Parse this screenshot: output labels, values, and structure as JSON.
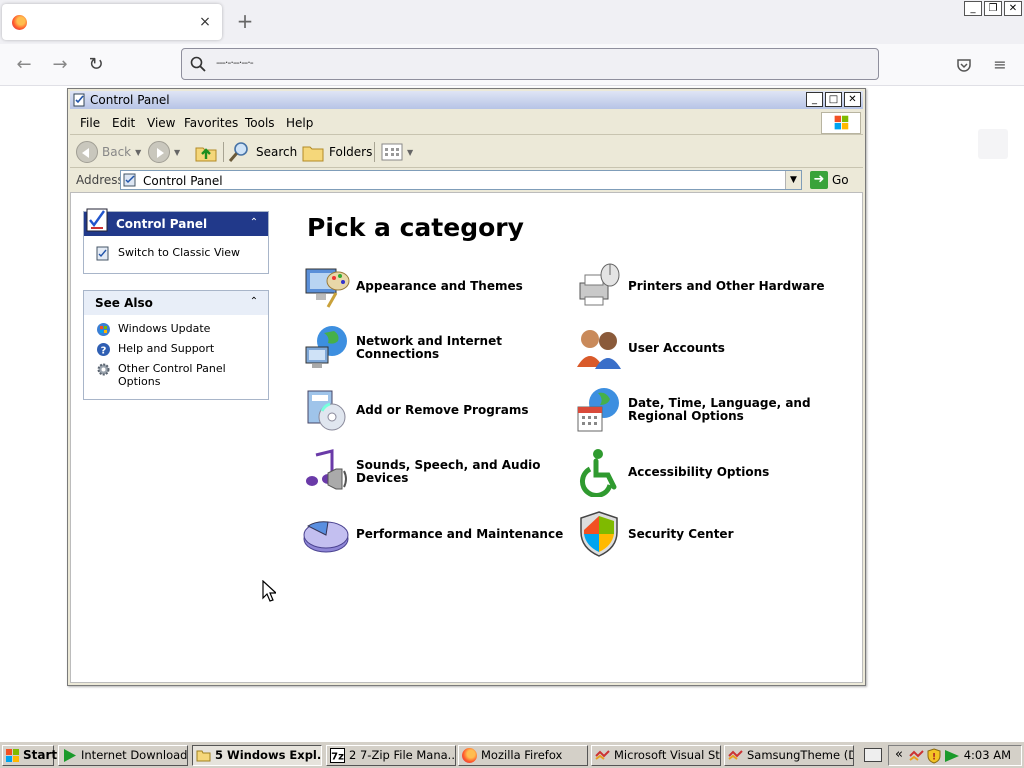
{
  "browser": {
    "tab_close": "×",
    "new_tab": "+",
    "url_text": "---·-·--·--·-",
    "nav": {
      "back": "←",
      "forward": "→",
      "reload": "↻"
    },
    "pocket_icon": "pocket-icon",
    "menu_icon": "≡"
  },
  "window_controls": {
    "minimize": "_",
    "restore": "❐",
    "close": "✕"
  },
  "window": {
    "title": "Control Panel",
    "controls": {
      "minimize": "_",
      "maximize": "□",
      "close": "✕"
    },
    "menu": [
      "File",
      "Edit",
      "View",
      "Favorites",
      "Tools",
      "Help"
    ],
    "toolbar": {
      "back": "Back",
      "search": "Search",
      "folders": "Folders"
    },
    "address": {
      "label": "Address",
      "value": "Control Panel",
      "go": "Go"
    }
  },
  "sidebar": {
    "control_panel": {
      "title": "Control Panel",
      "collapse": "⌃",
      "link": "Switch to Classic View"
    },
    "see_also": {
      "title": "See Also",
      "collapse": "⌃",
      "links": [
        "Windows Update",
        "Help and Support",
        "Other Control Panel Options"
      ]
    }
  },
  "main": {
    "heading": "Pick a category",
    "categories": [
      "Appearance and Themes",
      "Printers and Other Hardware",
      "Network and Internet Connections",
      "User Accounts",
      "Add or Remove Programs",
      "Date, Time, Language, and Regional Options",
      "Sounds, Speech, and Audio Devices",
      "Accessibility Options",
      "Performance and Maintenance",
      "Security Center"
    ]
  },
  "taskbar": {
    "start": "Start",
    "buttons": [
      "Internet Download...",
      "5 Windows Expl...",
      "2 7-Zip File Mana...",
      "Mozilla Firefox",
      "Microsoft Visual St...",
      "SamsungTheme (D..."
    ],
    "tray_expand": "«",
    "clock": "4:03 AM"
  },
  "colors": {
    "xp_panel_blue": "#21398a",
    "xp_face": "#ece9d8",
    "taskbar": "#d4d0c8"
  }
}
